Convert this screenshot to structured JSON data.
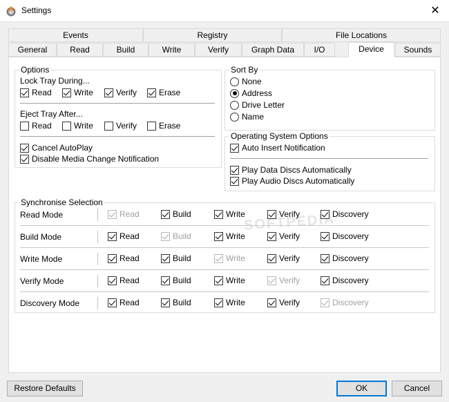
{
  "window": {
    "title": "Settings",
    "close_glyph": "✕"
  },
  "tabs_row1": [
    "Events",
    "Registry",
    "File Locations"
  ],
  "tabs_row2": [
    "General",
    "Read",
    "Build",
    "Write",
    "Verify",
    "Graph Data",
    "I/O",
    "Device",
    "Sounds"
  ],
  "active_tab": "Device",
  "options": {
    "title": "Options",
    "lock_title": "Lock Tray During...",
    "lock": [
      {
        "label": "Read",
        "checked": true
      },
      {
        "label": "Write",
        "checked": true
      },
      {
        "label": "Verify",
        "checked": true
      },
      {
        "label": "Erase",
        "checked": true
      }
    ],
    "eject_title": "Eject Tray After...",
    "eject": [
      {
        "label": "Read",
        "checked": false
      },
      {
        "label": "Write",
        "checked": false
      },
      {
        "label": "Verify",
        "checked": false
      },
      {
        "label": "Erase",
        "checked": false
      }
    ],
    "cancel_autoplay": {
      "label": "Cancel AutoPlay",
      "checked": true
    },
    "disable_media": {
      "label": "Disable Media Change Notification",
      "checked": true
    }
  },
  "sort_by": {
    "title": "Sort By",
    "options": [
      {
        "label": "None",
        "selected": false
      },
      {
        "label": "Address",
        "selected": true
      },
      {
        "label": "Drive Letter",
        "selected": false
      },
      {
        "label": "Name",
        "selected": false
      }
    ]
  },
  "os_options": {
    "title": "Operating System Options",
    "auto_insert": {
      "label": "Auto Insert Notification",
      "checked": true
    },
    "play_data": {
      "label": "Play Data Discs Automatically",
      "checked": true
    },
    "play_audio": {
      "label": "Play Audio Discs Automatically",
      "checked": true
    }
  },
  "sync": {
    "title": "Synchronise Selection",
    "columns": [
      "Read",
      "Build",
      "Write",
      "Verify",
      "Discovery"
    ],
    "rows": [
      {
        "label": "Read Mode",
        "disabled_index": 0
      },
      {
        "label": "Build Mode",
        "disabled_index": 1
      },
      {
        "label": "Write Mode",
        "disabled_index": 2
      },
      {
        "label": "Verify Mode",
        "disabled_index": 3
      },
      {
        "label": "Discovery Mode",
        "disabled_index": 4
      }
    ]
  },
  "watermark": "SOFTPEDIA",
  "buttons": {
    "restore": "Restore Defaults",
    "ok": "OK",
    "cancel": "Cancel"
  }
}
